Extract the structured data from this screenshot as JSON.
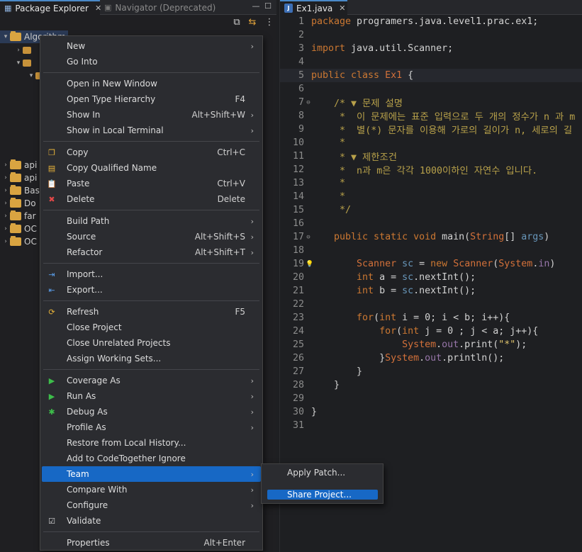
{
  "left_tabs": {
    "package_explorer": "Package Explorer",
    "navigator": "Navigator (Deprecated)"
  },
  "tree": [
    {
      "label": "Algorithm",
      "expanded": true,
      "selected": true
    },
    {
      "label": "api"
    },
    {
      "label": "api"
    },
    {
      "label": "Bas"
    },
    {
      "label": "Do"
    },
    {
      "label": "far"
    },
    {
      "label": "OC"
    },
    {
      "label": "OC"
    }
  ],
  "editor": {
    "tab_label": "Ex1.java",
    "lines": [
      {
        "n": "1",
        "segs": [
          [
            "kw",
            "package"
          ],
          [
            "pl",
            " programers.java.level1.prac.ex1;"
          ]
        ]
      },
      {
        "n": "2",
        "segs": []
      },
      {
        "n": "3",
        "segs": [
          [
            "kw",
            "import"
          ],
          [
            "pl",
            " java.util.Scanner;"
          ]
        ]
      },
      {
        "n": "4",
        "segs": []
      },
      {
        "n": "5",
        "segs": [
          [
            "kw",
            "public class"
          ],
          [
            "pl",
            " "
          ],
          [
            "typ",
            "Ex1"
          ],
          [
            "pl",
            " {"
          ]
        ],
        "current": true
      },
      {
        "n": "6",
        "segs": []
      },
      {
        "n": "7",
        "fold": true,
        "segs": [
          [
            "cm",
            "    /* ▼ 문제 설명"
          ]
        ]
      },
      {
        "n": "8",
        "segs": [
          [
            "cm",
            "     *  이 문제에는 표준 입력으로 두 개의 정수가 n 과 m"
          ]
        ]
      },
      {
        "n": "9",
        "segs": [
          [
            "cm",
            "     *  별(*) 문자를 이용해 가로의 길이가 n, 세로의 길"
          ]
        ]
      },
      {
        "n": "10",
        "segs": [
          [
            "cm",
            "     *"
          ]
        ]
      },
      {
        "n": "11",
        "segs": [
          [
            "cm",
            "     * ▼ 제한조건"
          ]
        ]
      },
      {
        "n": "12",
        "segs": [
          [
            "cm",
            "     *  n과 m은 각각 1000이하인 자연수 입니다."
          ]
        ]
      },
      {
        "n": "13",
        "segs": [
          [
            "cm",
            "     *"
          ]
        ]
      },
      {
        "n": "14",
        "segs": [
          [
            "cm",
            "     *"
          ]
        ]
      },
      {
        "n": "15",
        "segs": [
          [
            "cm",
            "     */"
          ]
        ]
      },
      {
        "n": "16",
        "segs": []
      },
      {
        "n": "17",
        "fold": true,
        "segs": [
          [
            "kw",
            "    public static void"
          ],
          [
            "pl",
            " main("
          ],
          [
            "typ",
            "String"
          ],
          [
            "pl",
            "[] "
          ],
          [
            "kw2",
            "args"
          ],
          [
            "pl",
            ")"
          ]
        ]
      },
      {
        "n": "18",
        "segs": []
      },
      {
        "n": "19",
        "bulb": true,
        "segs": [
          [
            "typ",
            "        Scanner"
          ],
          [
            "pl",
            " "
          ],
          [
            "kw2",
            "sc"
          ],
          [
            "pl",
            " = "
          ],
          [
            "kw",
            "new"
          ],
          [
            "pl",
            " "
          ],
          [
            "typ",
            "Scanner"
          ],
          [
            "pl",
            "("
          ],
          [
            "typ",
            "System"
          ],
          [
            "pl",
            "."
          ],
          [
            "fld",
            "in"
          ],
          [
            "pl",
            ")"
          ]
        ]
      },
      {
        "n": "20",
        "segs": [
          [
            "kw",
            "        int"
          ],
          [
            "pl",
            " a = "
          ],
          [
            "kw2",
            "sc"
          ],
          [
            "pl",
            ".nextInt();"
          ]
        ]
      },
      {
        "n": "21",
        "segs": [
          [
            "kw",
            "        int"
          ],
          [
            "pl",
            " b = "
          ],
          [
            "kw2",
            "sc"
          ],
          [
            "pl",
            ".nextInt();"
          ]
        ]
      },
      {
        "n": "22",
        "segs": []
      },
      {
        "n": "23",
        "segs": [
          [
            "kw",
            "        for"
          ],
          [
            "pl",
            "("
          ],
          [
            "kw",
            "int"
          ],
          [
            "pl",
            " i = 0; i < b; i++){"
          ]
        ]
      },
      {
        "n": "24",
        "segs": [
          [
            "kw",
            "            for"
          ],
          [
            "pl",
            "("
          ],
          [
            "kw",
            "int"
          ],
          [
            "pl",
            " j = 0 ; j < a; j++){"
          ]
        ]
      },
      {
        "n": "25",
        "segs": [
          [
            "typ",
            "                System"
          ],
          [
            "pl",
            "."
          ],
          [
            "fld",
            "out"
          ],
          [
            "pl",
            ".print("
          ],
          [
            "str",
            "\"*\""
          ],
          [
            "pl",
            ");"
          ]
        ]
      },
      {
        "n": "26",
        "segs": [
          [
            "pl",
            "            }"
          ],
          [
            "typ",
            "System"
          ],
          [
            "pl",
            "."
          ],
          [
            "fld",
            "out"
          ],
          [
            "pl",
            ".println();"
          ]
        ]
      },
      {
        "n": "27",
        "segs": [
          [
            "pl",
            "        }"
          ]
        ]
      },
      {
        "n": "28",
        "segs": [
          [
            "pl",
            "    }"
          ]
        ]
      },
      {
        "n": "29",
        "segs": []
      },
      {
        "n": "30",
        "segs": [
          [
            "pl",
            "}"
          ]
        ]
      },
      {
        "n": "31",
        "segs": []
      }
    ]
  },
  "context_menu": {
    "items": [
      {
        "label": "New",
        "submenu": true
      },
      {
        "label": "Go Into"
      },
      {
        "sep": true
      },
      {
        "label": "Open in New Window"
      },
      {
        "label": "Open Type Hierarchy",
        "shortcut": "F4"
      },
      {
        "label": "Show In",
        "shortcut": "Alt+Shift+W",
        "submenu": true
      },
      {
        "label": "Show in Local Terminal",
        "submenu": true
      },
      {
        "sep": true
      },
      {
        "label": "Copy",
        "shortcut": "Ctrl+C",
        "icon": "copy-icon"
      },
      {
        "label": "Copy Qualified Name",
        "icon": "copy-qualified-name-icon"
      },
      {
        "label": "Paste",
        "shortcut": "Ctrl+V",
        "icon": "paste-icon"
      },
      {
        "label": "Delete",
        "shortcut": "Delete",
        "icon": "delete-icon"
      },
      {
        "sep": true
      },
      {
        "label": "Build Path",
        "submenu": true
      },
      {
        "label": "Source",
        "shortcut": "Alt+Shift+S",
        "submenu": true
      },
      {
        "label": "Refactor",
        "shortcut": "Alt+Shift+T",
        "submenu": true
      },
      {
        "sep": true
      },
      {
        "label": "Import...",
        "icon": "import-icon"
      },
      {
        "label": "Export...",
        "icon": "export-icon"
      },
      {
        "sep": true
      },
      {
        "label": "Refresh",
        "shortcut": "F5",
        "icon": "refresh-icon"
      },
      {
        "label": "Close Project"
      },
      {
        "label": "Close Unrelated Projects"
      },
      {
        "label": "Assign Working Sets..."
      },
      {
        "sep": true
      },
      {
        "label": "Coverage As",
        "submenu": true,
        "icon": "coverage-icon"
      },
      {
        "label": "Run As",
        "submenu": true,
        "icon": "run-icon"
      },
      {
        "label": "Debug As",
        "submenu": true,
        "icon": "debug-icon"
      },
      {
        "label": "Profile As",
        "submenu": true
      },
      {
        "label": "Restore from Local History..."
      },
      {
        "label": "Add to CodeTogether Ignore"
      },
      {
        "label": "Team",
        "submenu": true,
        "active": true
      },
      {
        "label": "Compare With",
        "submenu": true
      },
      {
        "label": "Configure",
        "submenu": true
      },
      {
        "label": "Validate",
        "icon": "checkbox-icon"
      },
      {
        "sep": true
      },
      {
        "label": "Properties",
        "shortcut": "Alt+Enter"
      }
    ]
  },
  "team_submenu": {
    "items": [
      {
        "label": "Apply Patch..."
      },
      {
        "label": "Share Project...",
        "active": true
      }
    ]
  },
  "colors": {
    "menu_highlight": "#1768c5",
    "keyword": "#cc7832",
    "comment": "#b8a14a"
  }
}
